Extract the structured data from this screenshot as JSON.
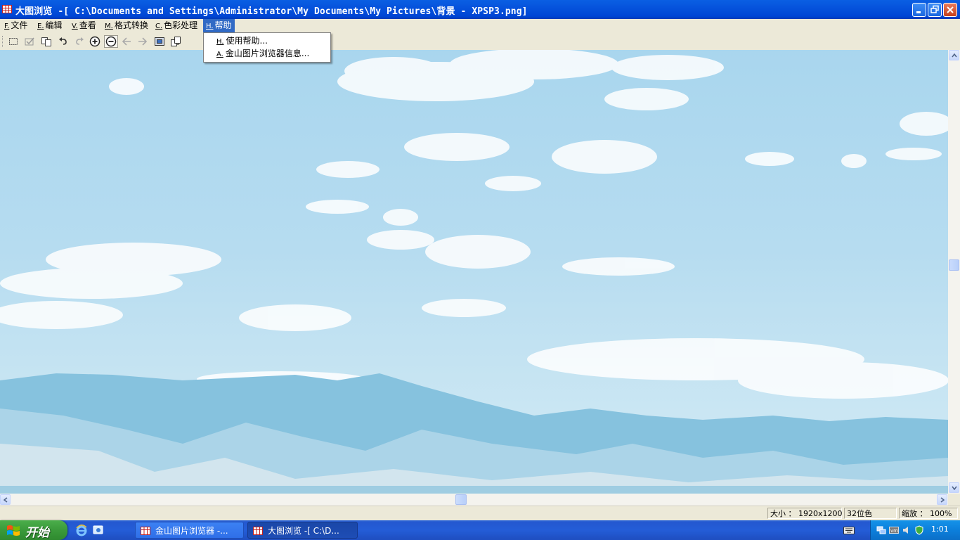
{
  "window": {
    "title": "大图浏览 -[ C:\\Documents and Settings\\Administrator\\My Documents\\My Pictures\\背景 - XPSP3.png]"
  },
  "menu": {
    "items": [
      {
        "acc": "F.",
        "label": "文件"
      },
      {
        "acc": "E.",
        "label": "编辑"
      },
      {
        "acc": "V.",
        "label": "查看"
      },
      {
        "acc": "M.",
        "label": "格式转换"
      },
      {
        "acc": "C.",
        "label": "色彩处理"
      },
      {
        "acc": "H.",
        "label": "帮助"
      }
    ],
    "active_index": 5,
    "dropdown": [
      {
        "acc": "H.",
        "label": "使用帮助..."
      },
      {
        "acc": "A.",
        "label": "金山图片浏览器信息..."
      }
    ]
  },
  "toolbar": {
    "icons": [
      "select-rect-icon",
      "check-icon",
      "copy-icon",
      "undo-icon",
      "redo-icon",
      "zoom-in-icon",
      "zoom-out-icon",
      "prev-arrow-icon",
      "next-arrow-icon",
      "fit-window-icon",
      "rotate-icon"
    ]
  },
  "status": {
    "size_label": "大小 ： 1920x1200",
    "color_depth": "32位色",
    "zoom_label": "缩放 ： 100%"
  },
  "taskbar": {
    "start_label": "开始",
    "tasks": [
      {
        "label": "金山图片浏览器 -..."
      },
      {
        "label": "大图浏览 -[ C:\\D..."
      }
    ],
    "active_task": 1,
    "clock": "1:01"
  },
  "colors": {
    "title_bar": "#0653dc",
    "menu_highlight": "#316ac5",
    "sky": "#b6dcf0",
    "mountain": "#86c2de",
    "start_green": "#3a9a3a",
    "taskbar_blue": "#245dd7"
  }
}
